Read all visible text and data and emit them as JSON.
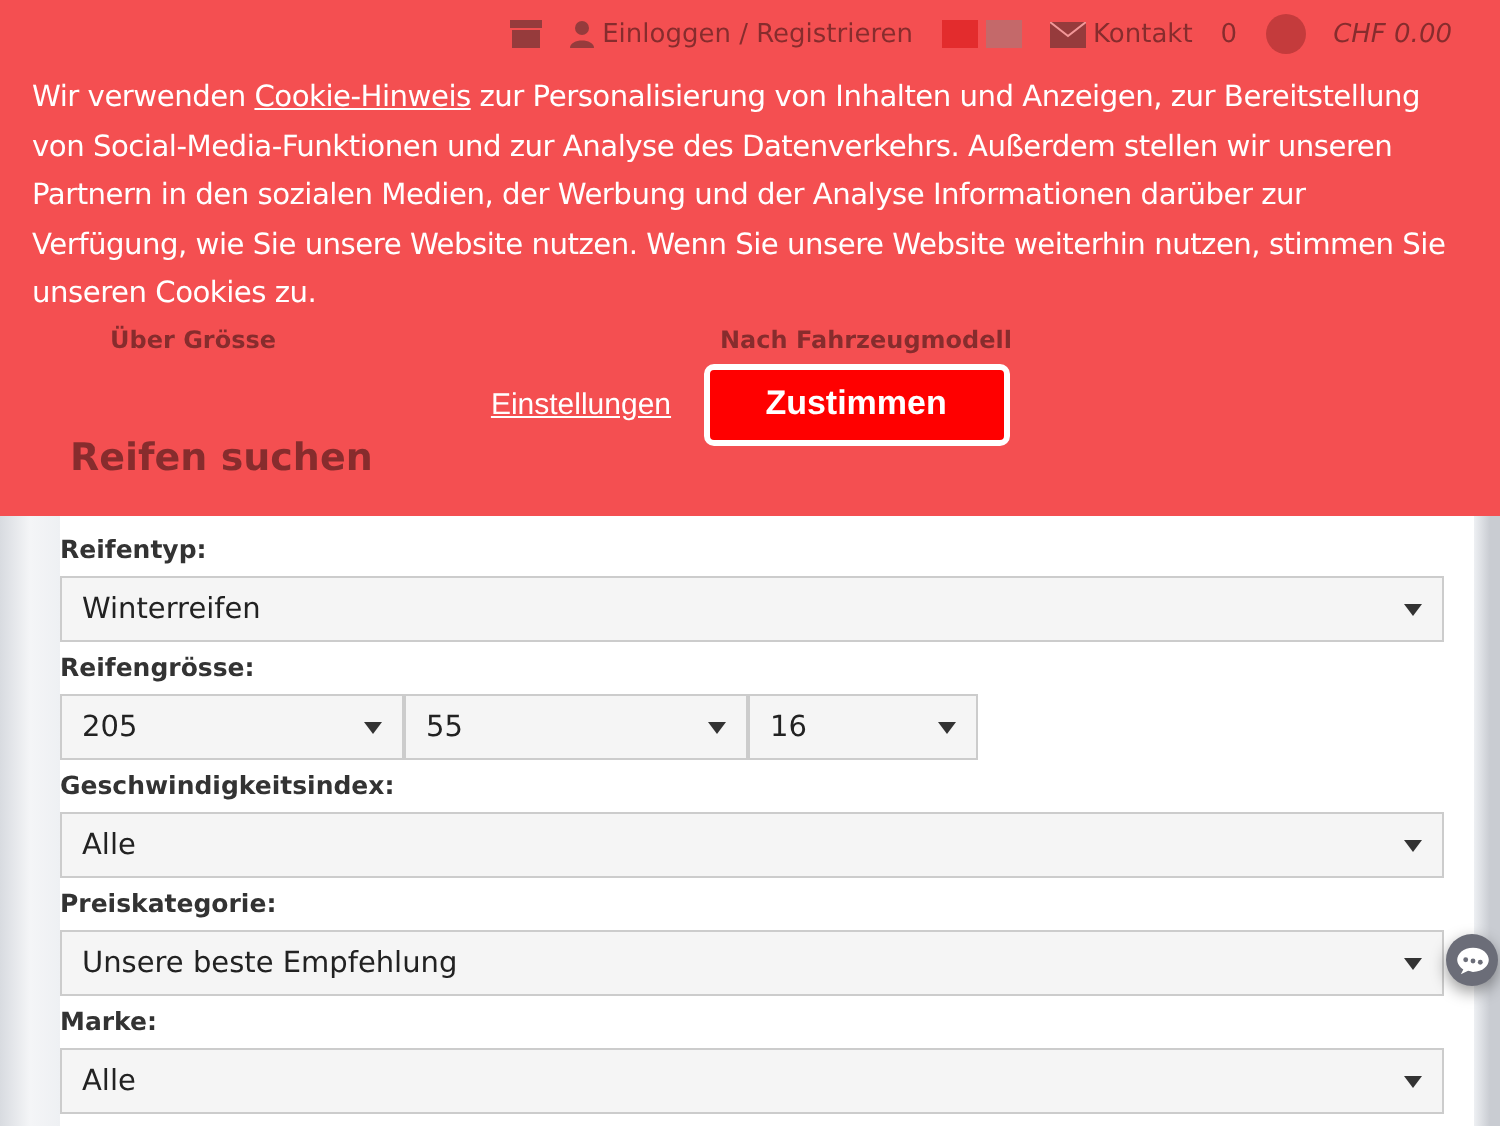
{
  "header": {
    "login": "Einloggen / Registrieren",
    "contact": "Kontakt",
    "cart_count": "0",
    "cart_total": "CHF 0.00"
  },
  "search_tabs": [
    {
      "label": "Über Grösse"
    },
    {
      "label": "Nach Fahrzeugmodell"
    }
  ],
  "search_title": "Reifen suchen",
  "cookie_banner": {
    "text_before": "Wir verwenden ",
    "link": "Cookie-Hinweis",
    "text_after": " zur Personalisierung von Inhalten und Anzeigen, zur Bereitstellung von Social-Media-Funktionen und zur Analyse des Datenverkehrs. Außerdem stellen wir unseren Partnern in den sozialen Medien, der Werbung und der Analyse Informationen darüber zur Verfügung, wie Sie unsere Website nutzen. Wenn Sie unsere Website weiterhin nutzen, stimmen Sie unseren Cookies zu.",
    "settings": "Einstellungen",
    "accept": "Zustimmen"
  },
  "form": [
    {
      "kind": "select",
      "label": "Reifentyp:",
      "value": "Winterreifen"
    },
    {
      "kind": "size",
      "label": "Reifengrösse:",
      "values": [
        "205",
        "55",
        "16"
      ]
    },
    {
      "kind": "select",
      "label": "Geschwindigkeitsindex:",
      "value": "Alle"
    },
    {
      "kind": "select",
      "label": "Preiskategorie:",
      "value": "Unsere beste Empfehlung"
    },
    {
      "kind": "select",
      "label": "Marke:",
      "value": "Alle"
    }
  ]
}
